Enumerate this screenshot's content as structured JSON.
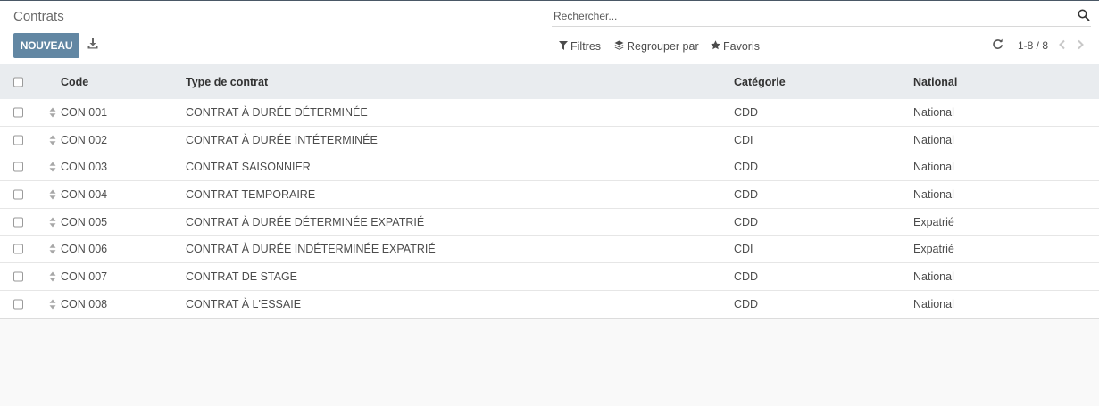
{
  "header": {
    "breadcrumb": "Contrats",
    "new_button_label": "NOUVEAU",
    "search_placeholder": "Rechercher...",
    "filters_label": "Filtres",
    "group_by_label": "Regrouper par",
    "favorites_label": "Favoris",
    "pager_value": "1-8 / 8"
  },
  "table": {
    "columns": {
      "code": "Code",
      "type": "Type de contrat",
      "category": "Catégorie",
      "national": "National"
    },
    "rows": [
      {
        "code": "CON 001",
        "type": "CONTRAT À DURÉE DÉTERMINÉE",
        "category": "CDD",
        "national": "National"
      },
      {
        "code": "CON 002",
        "type": "CONTRAT À DURÉE INTÉTERMINÉE",
        "category": "CDI",
        "national": "National"
      },
      {
        "code": "CON 003",
        "type": "CONTRAT SAISONNIER",
        "category": "CDD",
        "national": "National"
      },
      {
        "code": "CON 004",
        "type": "CONTRAT TEMPORAIRE",
        "category": "CDD",
        "national": "National"
      },
      {
        "code": "CON 005",
        "type": "CONTRAT À DURÉE DÉTERMINÉE EXPATRIÉ",
        "category": "CDD",
        "national": "Expatrié"
      },
      {
        "code": "CON 006",
        "type": "CONTRAT À DURÉE INDÉTERMINÉE EXPATRIÉ",
        "category": "CDI",
        "national": "Expatrié"
      },
      {
        "code": "CON 007",
        "type": "CONTRAT DE STAGE",
        "category": "CDD",
        "national": "National"
      },
      {
        "code": "CON 008",
        "type": "CONTRAT À L'ESSAIE",
        "category": "CDD",
        "national": "National"
      }
    ]
  },
  "colors": {
    "primary": "#6287a3",
    "header_row": "#e9ecef",
    "background": "#f9f9f9"
  },
  "icons": [
    "download-icon",
    "search-icon",
    "filter-icon",
    "layers-icon",
    "star-icon",
    "refresh-icon",
    "chevron-left-icon",
    "chevron-right-icon",
    "sort-handle-icon"
  ]
}
